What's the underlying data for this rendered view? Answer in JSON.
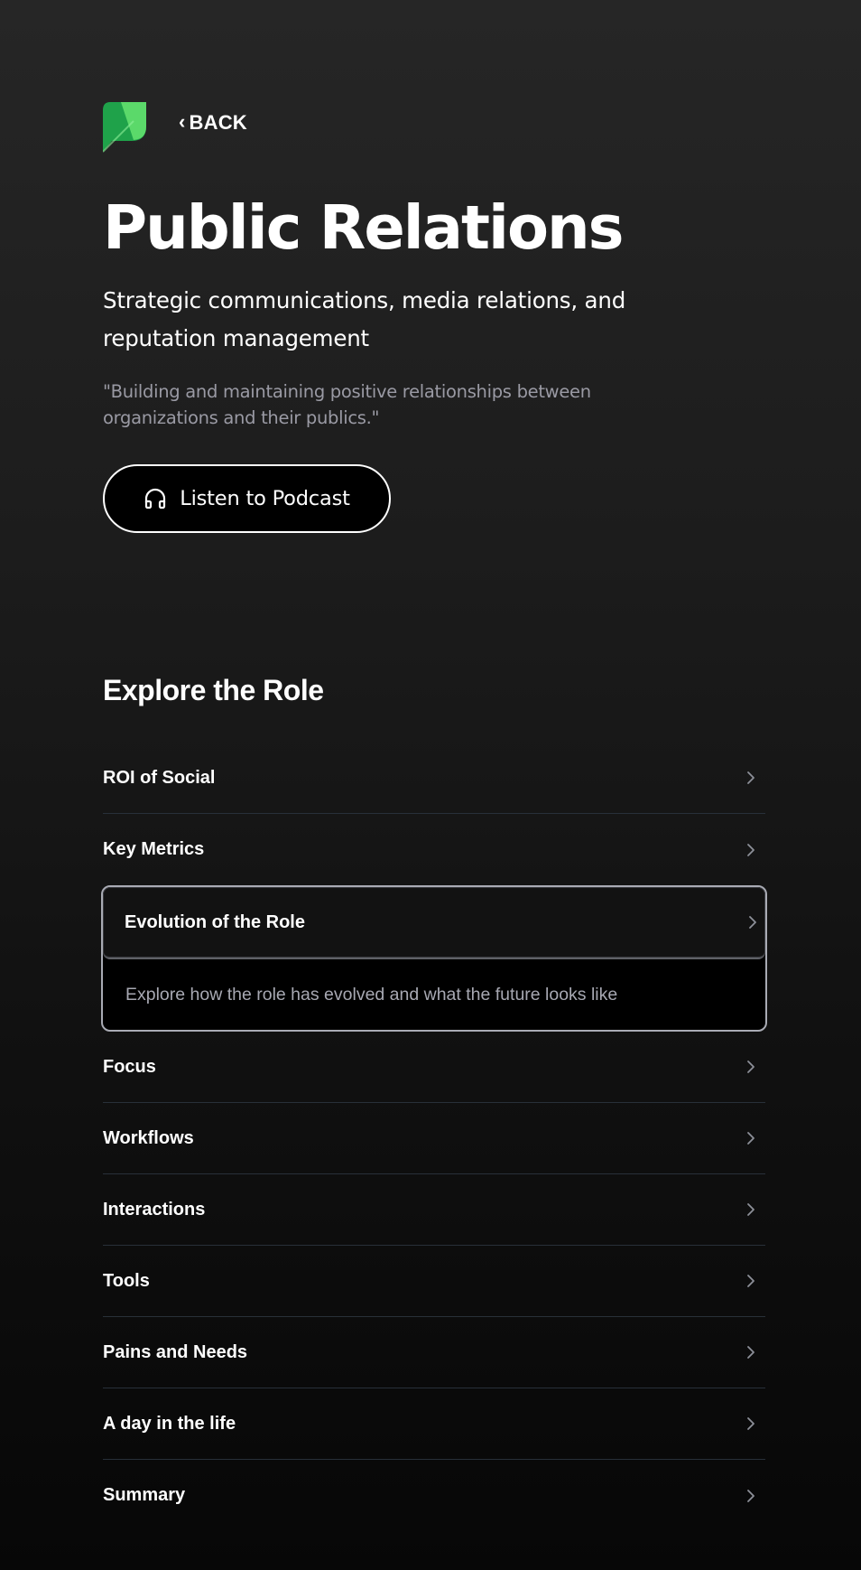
{
  "nav": {
    "back_label": "BACK"
  },
  "hero": {
    "title": "Public Relations",
    "subtitle": "Strategic communications, media relations, and reputation management",
    "quote": "\"Building and maintaining positive relationships between organizations and their publics.\"",
    "podcast_label": "Listen to Podcast"
  },
  "explore": {
    "title": "Explore the Role",
    "items": [
      {
        "label": "ROI of Social"
      },
      {
        "label": "Key Metrics"
      },
      {
        "label": "Evolution of the Role",
        "description": "Explore how the role has evolved and what the future looks like",
        "expanded": true
      },
      {
        "label": "Focus"
      },
      {
        "label": "Workflows"
      },
      {
        "label": "Interactions"
      },
      {
        "label": "Tools"
      },
      {
        "label": "Pains and Needs"
      },
      {
        "label": "A day in the life"
      },
      {
        "label": "Summary"
      }
    ]
  },
  "colors": {
    "logo_dark_green": "#1fa24a",
    "logo_light_green": "#5bd96a",
    "divider": "#283039",
    "muted_text": "#9a9aa4"
  }
}
